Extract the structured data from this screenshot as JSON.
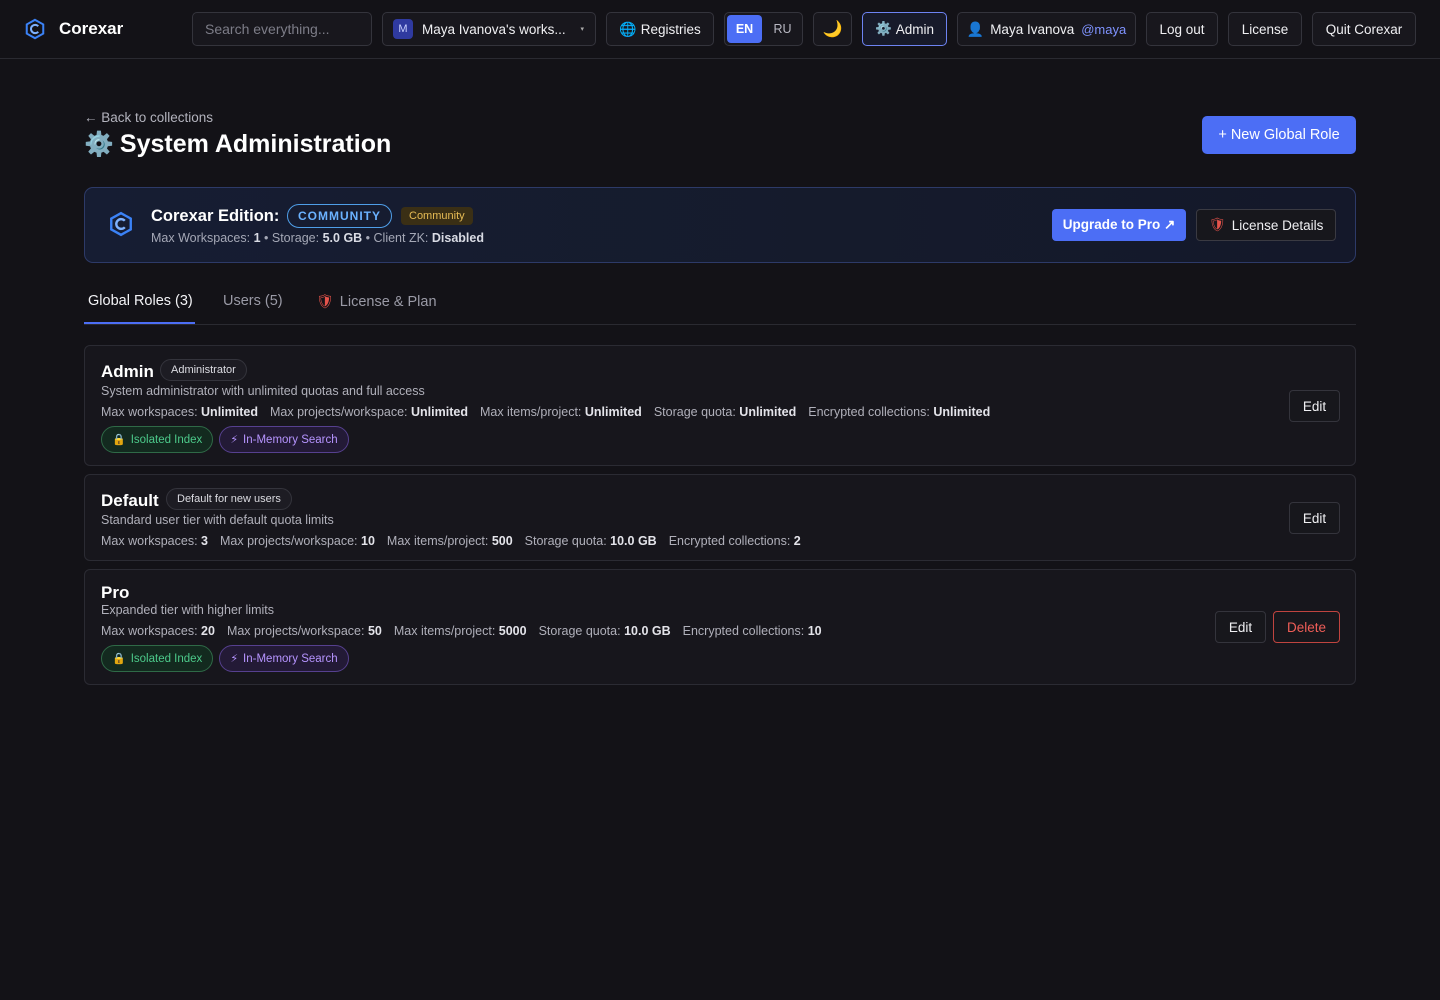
{
  "topbar": {
    "brand": "Corexar",
    "search_placeholder": "Search everything...",
    "workspace_avatar": "M",
    "workspace_label": "Maya Ivanova's works...",
    "workspace_caret": "▾",
    "registries_label": "Registries",
    "registries_icon": "🌐",
    "lang_en": "EN",
    "lang_ru": "RU",
    "theme_icon": "🌙",
    "admin_icon": "⚙️",
    "admin_label": "Admin",
    "user_icon": "👤",
    "user_name": "Maya Ivanova",
    "user_handle": "@maya",
    "logout_label": "Log out",
    "license_label": "License",
    "quit_label": "Quit Corexar"
  },
  "header": {
    "back_label": "← Back to collections",
    "title_icon": "⚙️",
    "title": "System Administration",
    "new_role_label": "+ New Global Role"
  },
  "edition": {
    "title": "Corexar Edition:",
    "badge": "COMMUNITY",
    "tier": "Community",
    "meta_workspaces_label": "Max Workspaces: ",
    "meta_workspaces_value": "1",
    "meta_storage_label": " • Storage: ",
    "meta_storage_value": "5.0 GB",
    "meta_zk_label": " • Client ZK: ",
    "meta_zk_value": "Disabled",
    "upgrade_label": "Upgrade to Pro ↗",
    "details_icon": "🛡",
    "details_label": "License Details"
  },
  "tabs": {
    "roles": "Global Roles (3)",
    "users": "Users (5)",
    "license_icon": "🛡",
    "license": "License & Plan"
  },
  "quota_labels": {
    "workspaces": "Max workspaces: ",
    "projects": "Max projects/workspace: ",
    "items": "Max items/project: ",
    "storage": "Storage quota: ",
    "encrypted": "Encrypted collections: "
  },
  "roles": [
    {
      "name": "Admin",
      "badge": "Administrator",
      "description": "System administrator with unlimited quotas and full access",
      "workspaces": "Unlimited",
      "projects": "Unlimited",
      "items": "Unlimited",
      "storage": "Unlimited",
      "encrypted": "Unlimited",
      "edit_label": "Edit"
    },
    {
      "name": "Default",
      "badge": "Default for new users",
      "description": "Standard user tier with default quota limits",
      "workspaces": "3",
      "projects": "10",
      "items": "500",
      "storage": "10.0 GB",
      "encrypted": "2",
      "edit_label": "Edit"
    },
    {
      "name": "Pro",
      "description": "Expanded tier with higher limits",
      "workspaces": "20",
      "projects": "50",
      "items": "5000",
      "storage": "10.0 GB",
      "encrypted": "10",
      "edit_label": "Edit",
      "delete_label": "Delete"
    }
  ],
  "features": {
    "isolated_icon": "🔒",
    "isolated": "Isolated Index",
    "memory_icon": "⚡",
    "memory": "In-Memory Search"
  },
  "colors": {
    "accent": "#4c6ef5",
    "background": "#131217",
    "danger": "#ef5d57",
    "community_badge": "#6bb2ff"
  }
}
